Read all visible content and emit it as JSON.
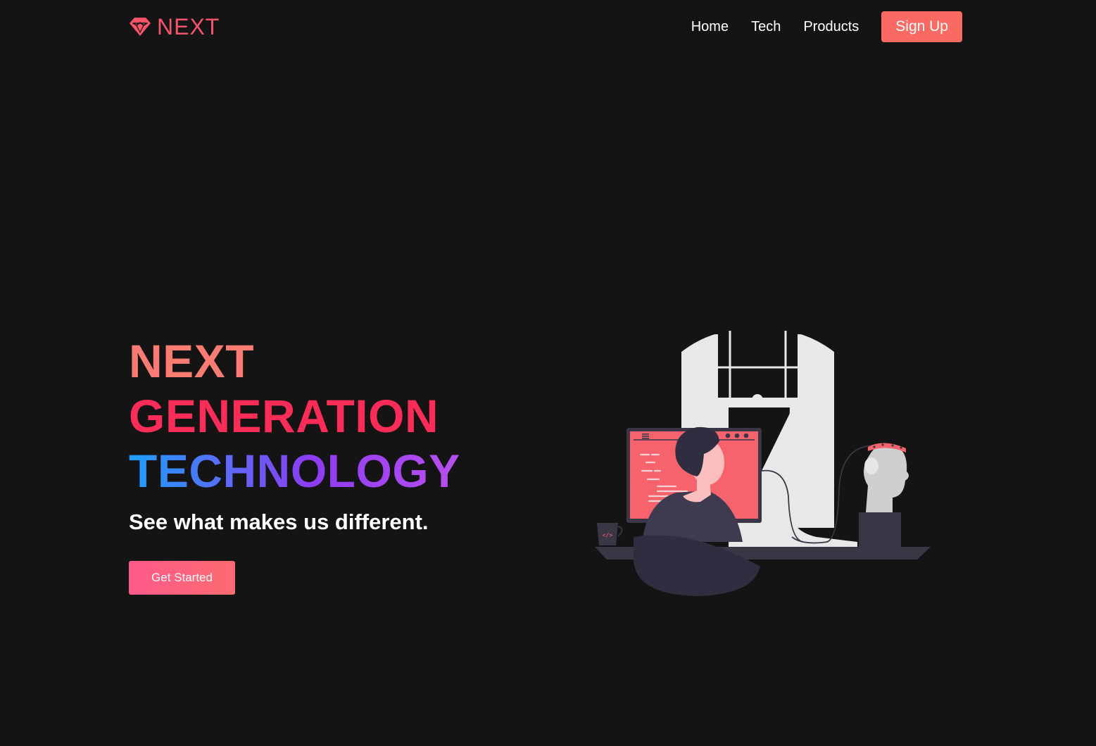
{
  "nav": {
    "brand": "NEXT",
    "links": [
      "Home",
      "Tech",
      "Products"
    ],
    "signup_label": "Sign Up"
  },
  "hero": {
    "line1": "NEXT",
    "line2": "GENERATION",
    "line3": "TECHNOLOGY",
    "subtitle": "See what makes us different.",
    "cta_label": "Get Started"
  },
  "colors": {
    "background": "#141414",
    "brand": "#f7546c",
    "signup_button": "#f96a62",
    "line1": "#fa7b72",
    "line2": "#fc2c58",
    "line3_gradient_start": "#1e9fff",
    "line3_gradient_end": "#b94ff0",
    "cta_gradient_start": "#fd5a8a",
    "cta_gradient_end": "#fd6b70"
  },
  "icons": {
    "logo": "diamond-gem-icon"
  },
  "illustration": {
    "subject": "developer-at-desk-illustration"
  }
}
